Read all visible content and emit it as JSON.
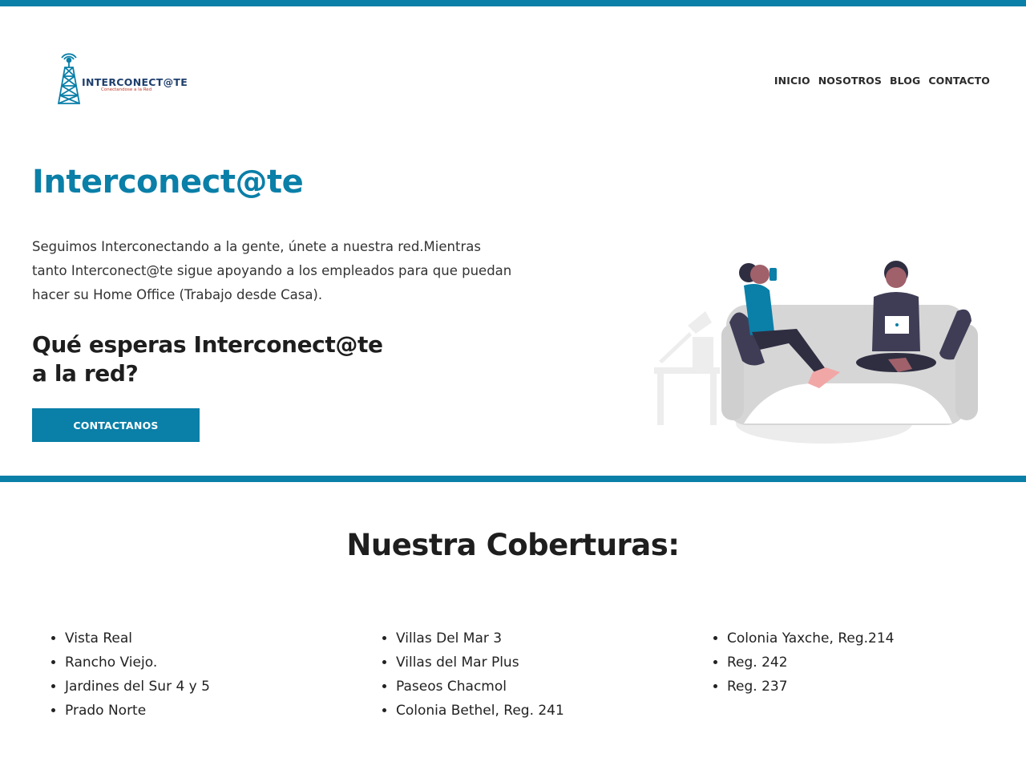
{
  "brand": {
    "logo_text": "INTERCONECT@TE",
    "logo_tagline": "Conectandose a la Red",
    "accent_color": "#0a7fa8"
  },
  "nav": {
    "items": [
      "INICIO",
      "NOSOTROS",
      "BLOG",
      "CONTACTO"
    ]
  },
  "hero": {
    "title": "Interconect@te",
    "text": "Seguimos Interconectando a la gente, únete a nuestra red.Mientras tanto Interconect@te sigue apoyando a los empleados para que puedan hacer su Home Office (Trabajo desde Casa).",
    "subtitle": "Qué esperas Interconect@te a la red?",
    "cta_label": "CONTACTANOS",
    "illustration": "people-on-sofa-with-devices"
  },
  "coverage": {
    "title": "Nuestra Coberturas:",
    "columns": [
      [
        "Vista Real",
        "Rancho Viejo.",
        "Jardines del Sur 4 y 5",
        "Prado Norte"
      ],
      [
        "Villas Del Mar 3",
        "Villas del Mar Plus",
        "Paseos Chacmol",
        "Colonia Bethel, Reg. 241"
      ],
      [
        "Colonia Yaxche, Reg.214",
        "Reg. 242",
        "Reg. 237"
      ]
    ]
  }
}
